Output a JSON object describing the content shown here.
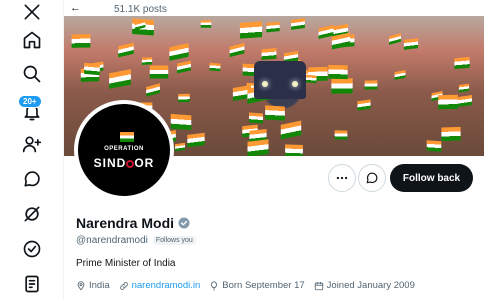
{
  "header": {
    "post_count": "51.1K posts"
  },
  "nav": {
    "items": [
      {
        "name": "x-logo-icon"
      },
      {
        "name": "home-icon"
      },
      {
        "name": "search-icon"
      },
      {
        "name": "notifications-icon"
      },
      {
        "name": "follow-icon"
      },
      {
        "name": "messages-icon"
      },
      {
        "name": "grok-icon"
      },
      {
        "name": "verified-orgs-icon"
      },
      {
        "name": "lists-icon"
      }
    ],
    "notification_badge": "20+"
  },
  "profile": {
    "avatar_text_line1": "OPERATION",
    "avatar_text_line2": "SIND",
    "avatar_text_line3": "OR",
    "name": "Narendra Modi",
    "handle": "@narendramodi",
    "follows_you": "Follows you",
    "bio": "Prime Minister of India",
    "location": "India",
    "website": "narendramodi.in",
    "born": "Born September 17",
    "joined": "Joined January 2009"
  },
  "actions": {
    "more_icon": "more-icon",
    "message_icon": "message-icon",
    "follow_back_label": "Follow back"
  },
  "colors": {
    "accent": "#1d9bf0",
    "text_primary": "#0f1419",
    "text_secondary": "#536471",
    "button_dark": "#0f1419"
  }
}
